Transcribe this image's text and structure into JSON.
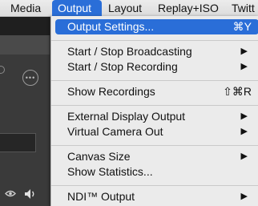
{
  "menubar": {
    "items": [
      "Media",
      "Output",
      "Layout",
      "Replay+ISO",
      "Twitt"
    ],
    "active_index": 1
  },
  "dropdown": {
    "items": [
      {
        "label": "Output Settings...",
        "shortcut": "⌘Y",
        "submenu": false,
        "selected": true
      },
      {
        "label": "Start / Stop Broadcasting",
        "submenu": true
      },
      {
        "label": "Start / Stop Recording",
        "submenu": true
      },
      {
        "label": "Show Recordings",
        "shortcut": "⇧⌘R",
        "submenu": false
      },
      {
        "label": "External Display Output",
        "submenu": true
      },
      {
        "label": "Virtual Camera Out",
        "submenu": true
      },
      {
        "label": "Canvas Size",
        "submenu": true
      },
      {
        "label": "Show Statistics...",
        "submenu": false
      },
      {
        "label": "NDI™ Output",
        "submenu": true
      }
    ],
    "submenu_glyph": "▶"
  },
  "background_app": {
    "more_icon_text": "•••"
  },
  "colors": {
    "highlight": "#2a6ed8",
    "menu_bg": "#ebebeb",
    "app_bg": "#3b3b3b"
  }
}
